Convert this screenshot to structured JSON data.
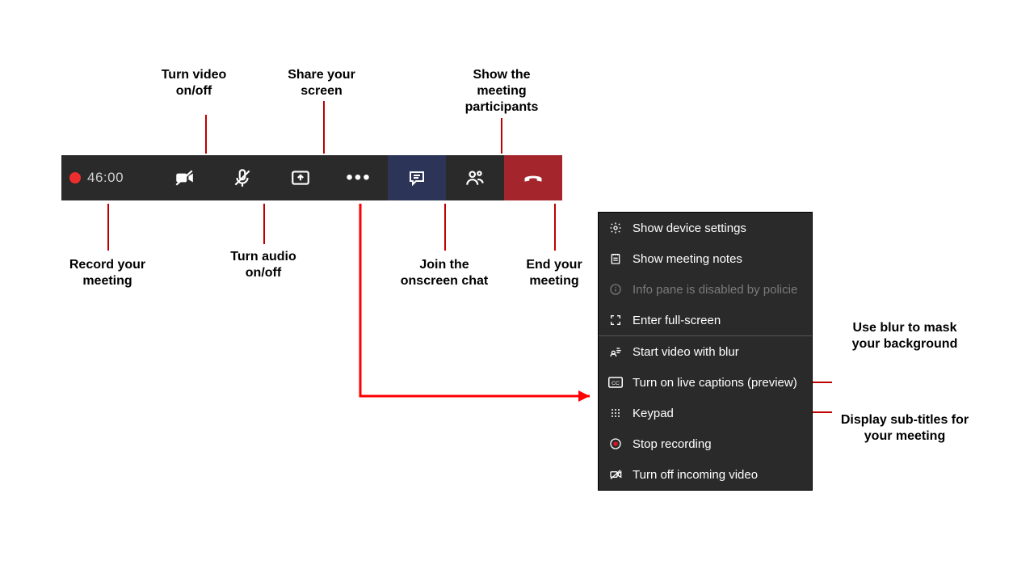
{
  "toolbar": {
    "time": "46:00"
  },
  "callouts": {
    "record": "Record your meeting",
    "video": "Turn video on/off",
    "audio": "Turn audio on/off",
    "share": "Share your screen",
    "participants": "Show the meeting participants",
    "chat": "Join  the onscreen chat",
    "end": "End your meeting",
    "blur": "Use blur to mask your background",
    "captions": "Display sub-titles for your meeting"
  },
  "menu": {
    "items": [
      {
        "label": "Show device settings",
        "icon": "gear",
        "enabled": true
      },
      {
        "label": "Show meeting notes",
        "icon": "notes",
        "enabled": true
      },
      {
        "label": "Info pane is disabled by policie",
        "icon": "info",
        "enabled": false
      },
      {
        "label": "Enter full-screen",
        "icon": "fullscreen",
        "enabled": true
      },
      {
        "sep": true
      },
      {
        "label": "Start video with blur",
        "icon": "blur",
        "enabled": true
      },
      {
        "label": "Turn on live captions (preview)",
        "icon": "cc",
        "enabled": true
      },
      {
        "label": "Keypad",
        "icon": "keypad",
        "enabled": true
      },
      {
        "label": "Stop recording",
        "icon": "rec",
        "enabled": true
      },
      {
        "label": "Turn off incoming video",
        "icon": "video-off",
        "enabled": true
      }
    ]
  }
}
